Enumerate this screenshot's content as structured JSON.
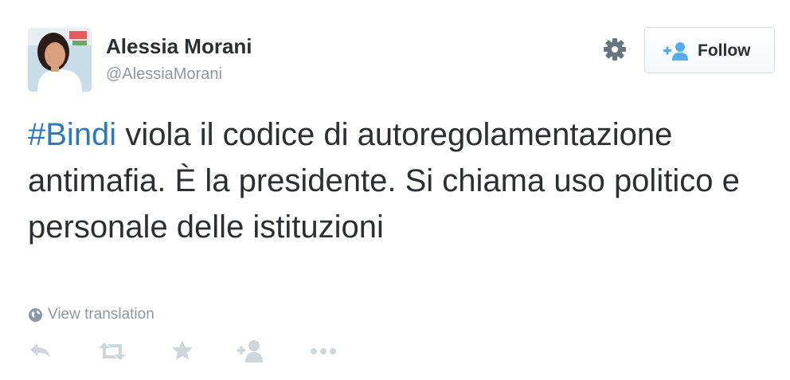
{
  "tweet": {
    "author_name": "Alessia Morani",
    "author_handle": "@AlessiaMorani",
    "hashtag": "#Bindi",
    "text_after_hashtag": " viola il codice di autoregolamentazione antimafia. È la presidente. Si chiama uso politico e personale delle istituzioni",
    "translate_label": "View translation"
  },
  "header": {
    "follow_label": "Follow"
  },
  "icons": {
    "settings": "gear-icon",
    "follow": "add-user-icon",
    "translate": "globe-icon",
    "reply": "reply-icon",
    "retweet": "retweet-icon",
    "favorite": "star-icon",
    "follow_action": "add-user-icon",
    "more": "more-dots-icon"
  },
  "colors": {
    "hashtag": "#2b7bb9",
    "text": "#292f33",
    "muted": "#8899a6",
    "action_icon": "#ccd6dd"
  }
}
